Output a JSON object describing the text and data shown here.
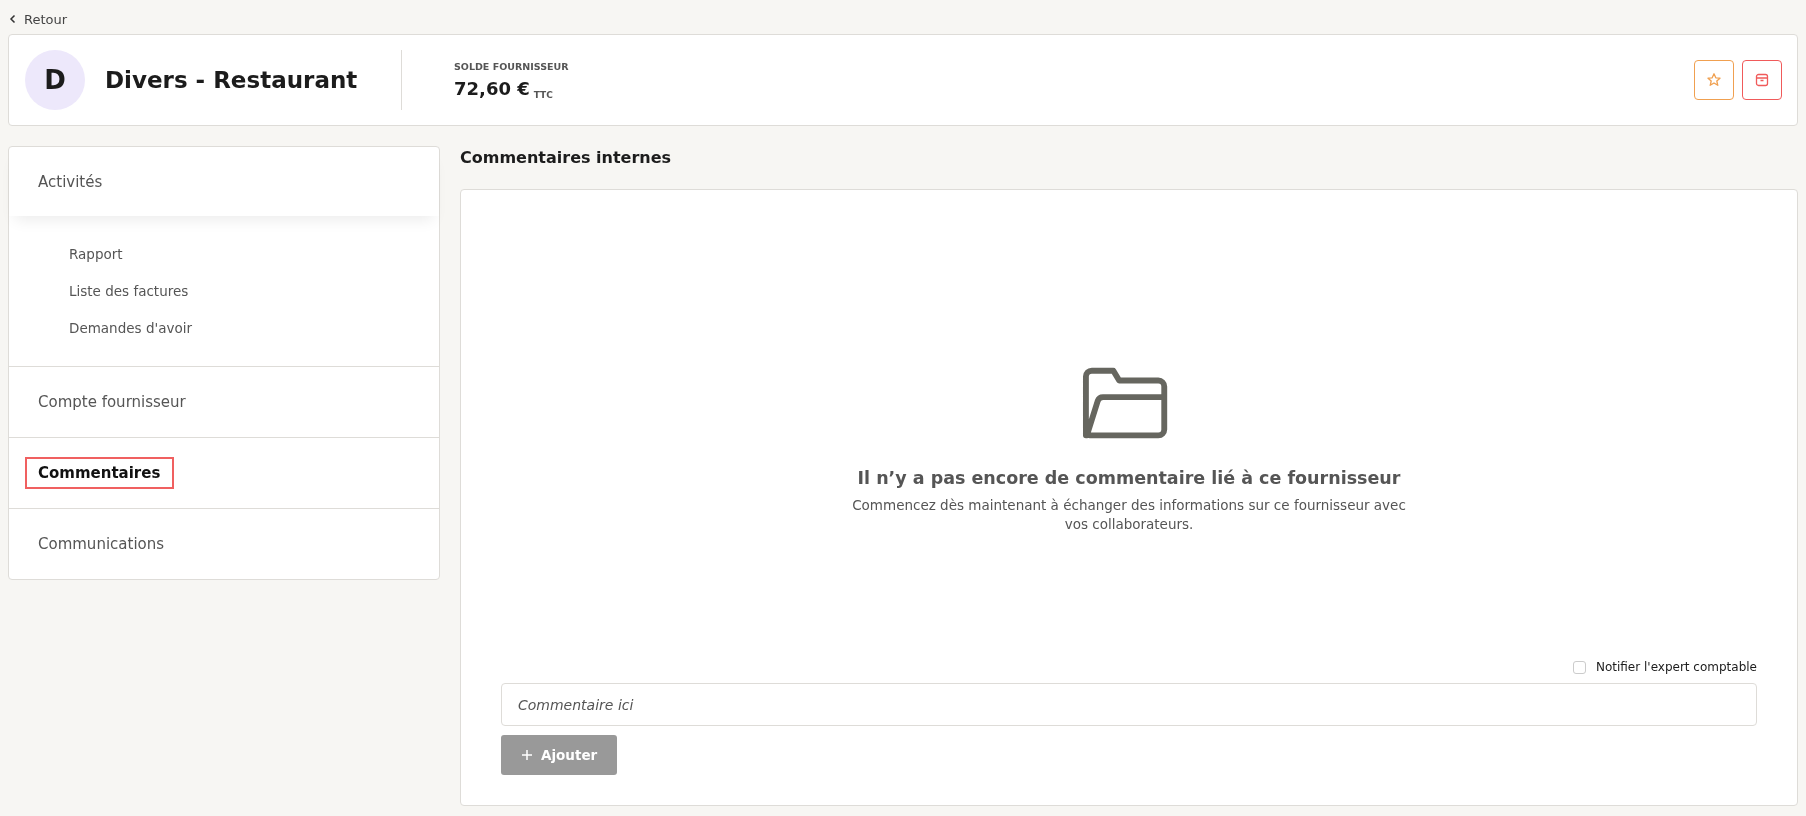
{
  "back_link": {
    "label": "Retour"
  },
  "supplier": {
    "initial": "D",
    "name": "Divers - Restaurant",
    "balance_label": "SOLDE FOURNISSEUR",
    "balance": "72,60 €",
    "balance_suffix": "TTC",
    "favorite": false
  },
  "sidebar": {
    "items": [
      {
        "label": "Activités",
        "selected": false,
        "children": [
          {
            "label": "Rapport",
            "selected": false
          },
          {
            "label": "Liste des factures",
            "selected": false
          },
          {
            "label": "Demandes d'avoir",
            "selected": false
          }
        ]
      },
      {
        "label": "Compte fournisseur",
        "selected": false
      },
      {
        "label": "Commentaires",
        "selected": true
      },
      {
        "label": "Communications",
        "selected": false
      }
    ]
  },
  "comments": {
    "title": "Commentaires internes",
    "empty_title": "Il n’y a pas encore de commentaire lié à ce fournisseur",
    "empty_text": "Commencez dès maintenant à échanger des informations sur ce fournisseur avec vos collaborateurs.",
    "notify": {
      "label": "Notifier l'expert comptable",
      "checked": false
    },
    "input": {
      "placeholder": "Commentaire ici"
    },
    "add_button": {
      "label": "Ajouter",
      "disabled": true
    }
  }
}
